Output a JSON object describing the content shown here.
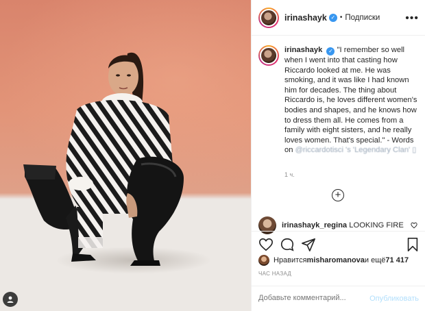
{
  "post": {
    "username": "irinashayk",
    "follow_label": "Подписки",
    "verified_glyph": "✓",
    "more_label": "•••",
    "caption_pre": "\"I remember so well when I went into that casting how Riccardo looked at me. He was smoking, and it was like I had known him for decades. The thing about Riccardo is, he loves different women's bodies and shapes, and he knows how to dress them all. He comes from a family with eight sisters, and he really loves women. That's special.\" - Words on ",
    "caption_blur1": "@riccardotisci",
    "caption_blur2": "'s 'Legendary Clan' ▯",
    "time": "1 ч."
  },
  "comment": {
    "username": "irinashayk_regina",
    "text": "LOOKING FIRE"
  },
  "likes": {
    "prefix": "Нравится ",
    "user": "misharomanova",
    "middle": " и ещё ",
    "count": "71 417"
  },
  "ago": "ЧАС НАЗАД",
  "add_comment": {
    "placeholder": "Добавьте комментарий...",
    "publish": "Опубликовать"
  },
  "icons": {
    "plus": "+",
    "accent": "#3897f0"
  }
}
